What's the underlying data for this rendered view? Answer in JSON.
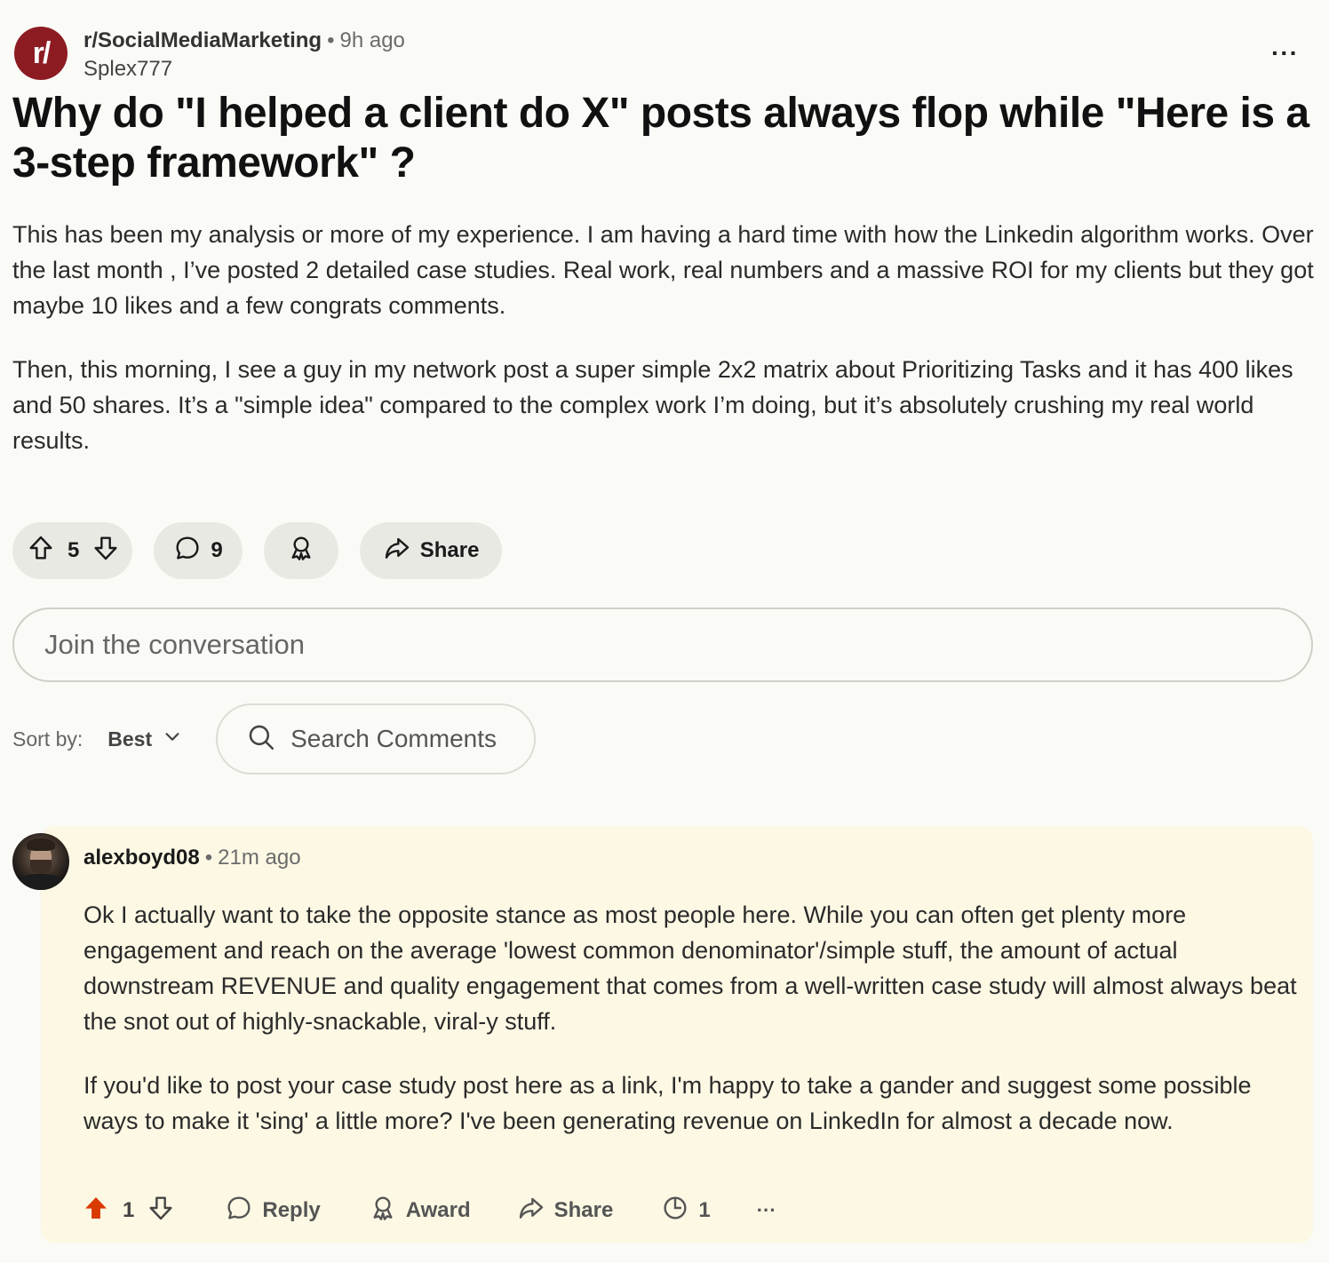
{
  "post": {
    "subreddit": "r/SocialMediaMarketing",
    "subreddit_icon_text": "r/",
    "time": "9h ago",
    "author": "Splex777",
    "title": "Why do \"I helped a client do X\" posts always flop while \"Here is a 3-step framework\" ?",
    "body": [
      "This has been my analysis or more of my experience. I am having a hard time with how the Linkedin algorithm works. Over the last month , I’ve posted 2 detailed case studies. Real work, real numbers and a massive ROI for my clients but they got maybe 10 likes and a few congrats comments.",
      "Then, this morning, I see a guy in my network post a super simple 2x2 matrix about Prioritizing Tasks and it has 400 likes and 50 shares. It’s a \"simple idea\" compared to the complex work I’m doing, but it’s absolutely crushing my real world results."
    ],
    "votes": "5",
    "comments": "9",
    "share_label": "Share",
    "more_label": "···"
  },
  "composer": {
    "placeholder": "Join the conversation"
  },
  "sort": {
    "label": "Sort by:",
    "value": "Best",
    "search_placeholder": "Search Comments"
  },
  "comment": {
    "author": "alexboyd08",
    "time": "21m ago",
    "body": [
      "Ok I actually want to take the opposite stance as most people here. While you can often get plenty more engagement and reach on the average 'lowest common denominator'/simple stuff, the amount of actual downstream REVENUE and quality engagement that comes from a well-written case study will almost always beat the snot out of highly-snackable, viral-y stuff.",
      "If you'd like to post your case study post here as a link, I'm happy to take a gander and suggest some possible ways to make it 'sing' a little more? I've been generating revenue on LinkedIn for almost a decade now."
    ],
    "votes": "1",
    "reply_label": "Reply",
    "award_label": "Award",
    "share_label": "Share",
    "history_count": "1",
    "more_label": "···"
  },
  "colors": {
    "upvote_active": "#d93a00",
    "subreddit_icon_bg": "#8c1c22",
    "comment_highlight_bg": "#fdf8e4"
  }
}
